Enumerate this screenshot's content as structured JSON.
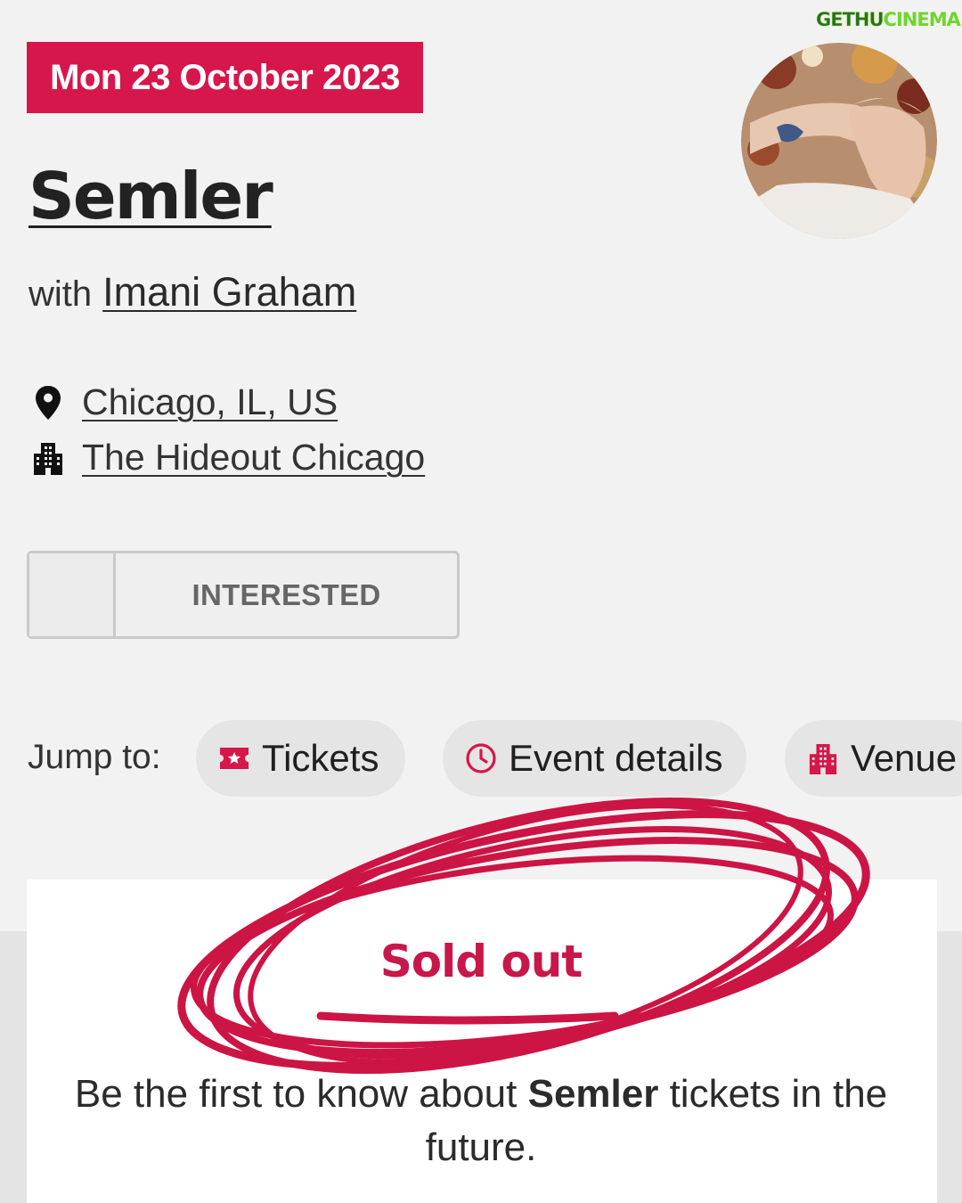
{
  "event": {
    "date": "Mon 23 October 2023",
    "artist": "Semler",
    "support_prefix": "with",
    "support_artist": "Imani Graham",
    "location": "Chicago, IL, US",
    "venue": "The Hideout Chicago"
  },
  "rsvp": {
    "interested_label": "INTERESTED"
  },
  "jump_to": {
    "label": "Jump to:",
    "items": [
      {
        "label": "Tickets",
        "icon": "ticket-icon"
      },
      {
        "label": "Event details",
        "icon": "clock-icon"
      },
      {
        "label": "Venue",
        "icon": "building-icon"
      }
    ]
  },
  "tickets": {
    "status": "Sold out",
    "message_before": "Be the first to know about ",
    "message_artist": "Semler",
    "message_after": " tickets in the future."
  },
  "watermark": {
    "part1": "GETHU",
    "part2": "CINEMA"
  },
  "colors": {
    "accent": "#d6174b",
    "background": "#f2f2f2",
    "scribble": "#cc1445"
  }
}
